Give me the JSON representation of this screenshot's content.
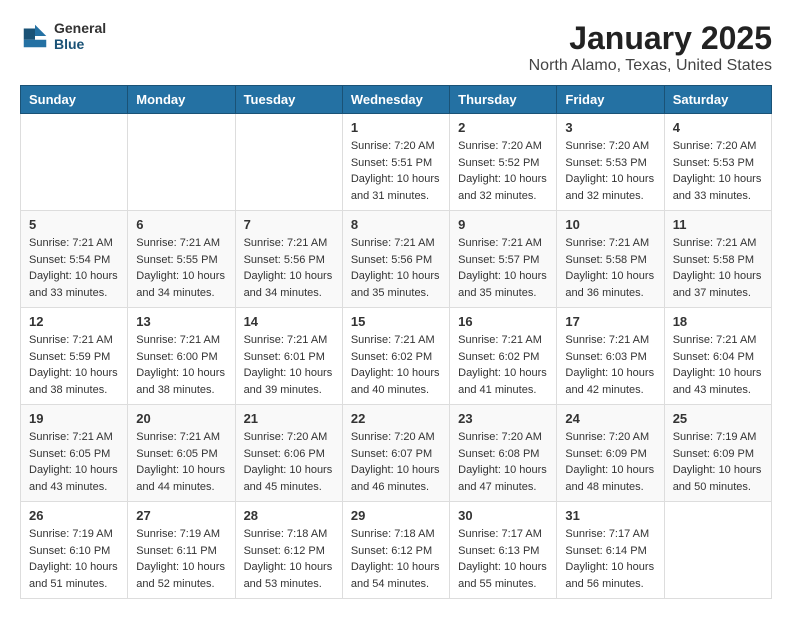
{
  "header": {
    "logo_general": "General",
    "logo_blue": "Blue",
    "title": "January 2025",
    "subtitle": "North Alamo, Texas, United States"
  },
  "days_of_week": [
    "Sunday",
    "Monday",
    "Tuesday",
    "Wednesday",
    "Thursday",
    "Friday",
    "Saturday"
  ],
  "weeks": [
    [
      {
        "day": "",
        "sunrise": "",
        "sunset": "",
        "daylight": ""
      },
      {
        "day": "",
        "sunrise": "",
        "sunset": "",
        "daylight": ""
      },
      {
        "day": "",
        "sunrise": "",
        "sunset": "",
        "daylight": ""
      },
      {
        "day": "1",
        "sunrise": "Sunrise: 7:20 AM",
        "sunset": "Sunset: 5:51 PM",
        "daylight": "Daylight: 10 hours and 31 minutes."
      },
      {
        "day": "2",
        "sunrise": "Sunrise: 7:20 AM",
        "sunset": "Sunset: 5:52 PM",
        "daylight": "Daylight: 10 hours and 32 minutes."
      },
      {
        "day": "3",
        "sunrise": "Sunrise: 7:20 AM",
        "sunset": "Sunset: 5:53 PM",
        "daylight": "Daylight: 10 hours and 32 minutes."
      },
      {
        "day": "4",
        "sunrise": "Sunrise: 7:20 AM",
        "sunset": "Sunset: 5:53 PM",
        "daylight": "Daylight: 10 hours and 33 minutes."
      }
    ],
    [
      {
        "day": "5",
        "sunrise": "Sunrise: 7:21 AM",
        "sunset": "Sunset: 5:54 PM",
        "daylight": "Daylight: 10 hours and 33 minutes."
      },
      {
        "day": "6",
        "sunrise": "Sunrise: 7:21 AM",
        "sunset": "Sunset: 5:55 PM",
        "daylight": "Daylight: 10 hours and 34 minutes."
      },
      {
        "day": "7",
        "sunrise": "Sunrise: 7:21 AM",
        "sunset": "Sunset: 5:56 PM",
        "daylight": "Daylight: 10 hours and 34 minutes."
      },
      {
        "day": "8",
        "sunrise": "Sunrise: 7:21 AM",
        "sunset": "Sunset: 5:56 PM",
        "daylight": "Daylight: 10 hours and 35 minutes."
      },
      {
        "day": "9",
        "sunrise": "Sunrise: 7:21 AM",
        "sunset": "Sunset: 5:57 PM",
        "daylight": "Daylight: 10 hours and 35 minutes."
      },
      {
        "day": "10",
        "sunrise": "Sunrise: 7:21 AM",
        "sunset": "Sunset: 5:58 PM",
        "daylight": "Daylight: 10 hours and 36 minutes."
      },
      {
        "day": "11",
        "sunrise": "Sunrise: 7:21 AM",
        "sunset": "Sunset: 5:58 PM",
        "daylight": "Daylight: 10 hours and 37 minutes."
      }
    ],
    [
      {
        "day": "12",
        "sunrise": "Sunrise: 7:21 AM",
        "sunset": "Sunset: 5:59 PM",
        "daylight": "Daylight: 10 hours and 38 minutes."
      },
      {
        "day": "13",
        "sunrise": "Sunrise: 7:21 AM",
        "sunset": "Sunset: 6:00 PM",
        "daylight": "Daylight: 10 hours and 38 minutes."
      },
      {
        "day": "14",
        "sunrise": "Sunrise: 7:21 AM",
        "sunset": "Sunset: 6:01 PM",
        "daylight": "Daylight: 10 hours and 39 minutes."
      },
      {
        "day": "15",
        "sunrise": "Sunrise: 7:21 AM",
        "sunset": "Sunset: 6:02 PM",
        "daylight": "Daylight: 10 hours and 40 minutes."
      },
      {
        "day": "16",
        "sunrise": "Sunrise: 7:21 AM",
        "sunset": "Sunset: 6:02 PM",
        "daylight": "Daylight: 10 hours and 41 minutes."
      },
      {
        "day": "17",
        "sunrise": "Sunrise: 7:21 AM",
        "sunset": "Sunset: 6:03 PM",
        "daylight": "Daylight: 10 hours and 42 minutes."
      },
      {
        "day": "18",
        "sunrise": "Sunrise: 7:21 AM",
        "sunset": "Sunset: 6:04 PM",
        "daylight": "Daylight: 10 hours and 43 minutes."
      }
    ],
    [
      {
        "day": "19",
        "sunrise": "Sunrise: 7:21 AM",
        "sunset": "Sunset: 6:05 PM",
        "daylight": "Daylight: 10 hours and 43 minutes."
      },
      {
        "day": "20",
        "sunrise": "Sunrise: 7:21 AM",
        "sunset": "Sunset: 6:05 PM",
        "daylight": "Daylight: 10 hours and 44 minutes."
      },
      {
        "day": "21",
        "sunrise": "Sunrise: 7:20 AM",
        "sunset": "Sunset: 6:06 PM",
        "daylight": "Daylight: 10 hours and 45 minutes."
      },
      {
        "day": "22",
        "sunrise": "Sunrise: 7:20 AM",
        "sunset": "Sunset: 6:07 PM",
        "daylight": "Daylight: 10 hours and 46 minutes."
      },
      {
        "day": "23",
        "sunrise": "Sunrise: 7:20 AM",
        "sunset": "Sunset: 6:08 PM",
        "daylight": "Daylight: 10 hours and 47 minutes."
      },
      {
        "day": "24",
        "sunrise": "Sunrise: 7:20 AM",
        "sunset": "Sunset: 6:09 PM",
        "daylight": "Daylight: 10 hours and 48 minutes."
      },
      {
        "day": "25",
        "sunrise": "Sunrise: 7:19 AM",
        "sunset": "Sunset: 6:09 PM",
        "daylight": "Daylight: 10 hours and 50 minutes."
      }
    ],
    [
      {
        "day": "26",
        "sunrise": "Sunrise: 7:19 AM",
        "sunset": "Sunset: 6:10 PM",
        "daylight": "Daylight: 10 hours and 51 minutes."
      },
      {
        "day": "27",
        "sunrise": "Sunrise: 7:19 AM",
        "sunset": "Sunset: 6:11 PM",
        "daylight": "Daylight: 10 hours and 52 minutes."
      },
      {
        "day": "28",
        "sunrise": "Sunrise: 7:18 AM",
        "sunset": "Sunset: 6:12 PM",
        "daylight": "Daylight: 10 hours and 53 minutes."
      },
      {
        "day": "29",
        "sunrise": "Sunrise: 7:18 AM",
        "sunset": "Sunset: 6:12 PM",
        "daylight": "Daylight: 10 hours and 54 minutes."
      },
      {
        "day": "30",
        "sunrise": "Sunrise: 7:17 AM",
        "sunset": "Sunset: 6:13 PM",
        "daylight": "Daylight: 10 hours and 55 minutes."
      },
      {
        "day": "31",
        "sunrise": "Sunrise: 7:17 AM",
        "sunset": "Sunset: 6:14 PM",
        "daylight": "Daylight: 10 hours and 56 minutes."
      },
      {
        "day": "",
        "sunrise": "",
        "sunset": "",
        "daylight": ""
      }
    ]
  ]
}
